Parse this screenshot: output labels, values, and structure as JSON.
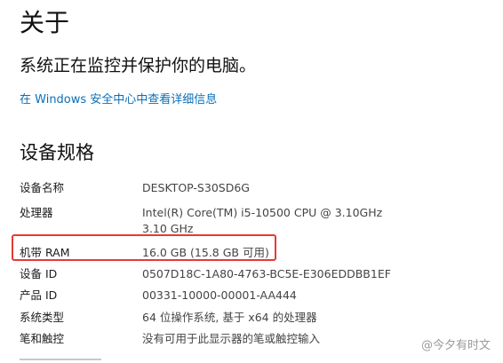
{
  "page": {
    "title": "关于",
    "status": "系统正在监控并保护你的电脑。",
    "security_link": "在 Windows 安全中心中查看详细信息"
  },
  "specs": {
    "section_title": "设备规格",
    "rows": [
      {
        "label": "设备名称",
        "value": "DESKTOP-S30SD6G"
      },
      {
        "label": "处理器",
        "value": "Intel(R) Core(TM) i5-10500 CPU @ 3.10GHz   3.10 GHz"
      },
      {
        "label": "机带 RAM",
        "value": "16.0 GB (15.8 GB 可用)"
      },
      {
        "label": "设备 ID",
        "value": "0507D18C-1A80-4763-BC5E-E306EDDBB1EF"
      },
      {
        "label": "产品 ID",
        "value": "00331-10000-00001-AA444"
      },
      {
        "label": "系统类型",
        "value": "64 位操作系统, 基于 x64 的处理器"
      },
      {
        "label": "笔和触控",
        "value": "没有可用于此显示器的笔或触控输入"
      }
    ]
  },
  "watermark": "@今夕有时文",
  "colors": {
    "link": "#0a6fb8",
    "highlight": "#e53935"
  }
}
